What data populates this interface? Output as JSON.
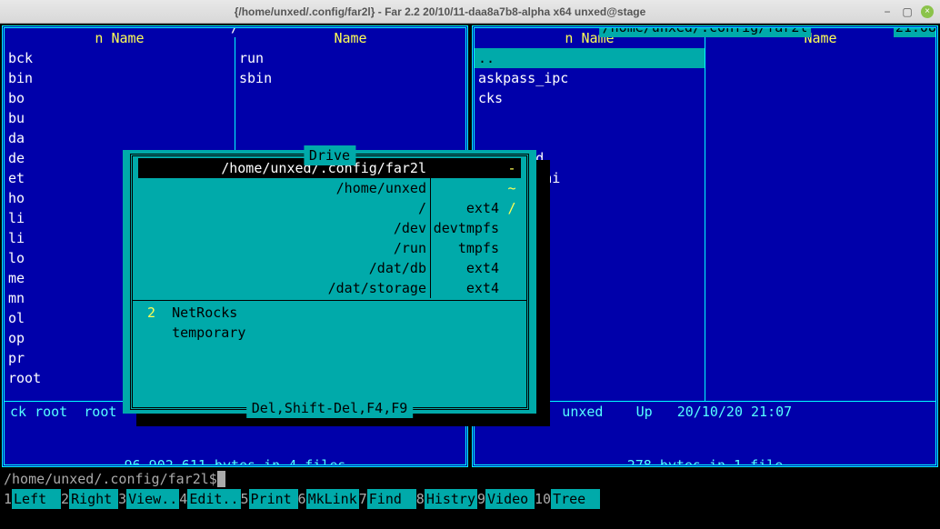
{
  "window": {
    "title": "{/home/unxed/.config/far2l} - Far 2.2 20/10/11-daa8a7b8-alpha x64 unxed@stage"
  },
  "clock": "21:08",
  "left_panel": {
    "path": "/",
    "col1_header": "n     Name",
    "col2_header": "Name",
    "col1": [
      "bck",
      "bin",
      "bo",
      "bu",
      "da",
      "de",
      "et",
      "ho",
      "li",
      "li",
      "lo",
      "me",
      "mn",
      "ol",
      "op",
      "pr",
      "root"
    ],
    "col2": [
      "run",
      "sbin"
    ],
    "stat": "ck root  root   Folder 08/09/17 14:09",
    "summary": "96 902 611 bytes in 4 files"
  },
  "right_panel": {
    "path": "/home/unxed/.config/far2l",
    "col1_header": "n     Name",
    "col2_header": "Name",
    "col1": [
      "..",
      "askpass_ipc",
      "cks",
      "",
      "",
      "lipboard",
      "pboard.ini"
    ],
    "stat": ".. unxed  unxed    Up   20/10/20 21:07",
    "summary": "278 bytes in 1 file"
  },
  "cmdline": {
    "prompt": "/home/unxed/.config/far2l$"
  },
  "fkeys": [
    {
      "n": "1",
      "l": "Left  "
    },
    {
      "n": "2",
      "l": "Right "
    },
    {
      "n": "3",
      "l": "View.."
    },
    {
      "n": "4",
      "l": "Edit.."
    },
    {
      "n": "5",
      "l": "Print "
    },
    {
      "n": "6",
      "l": "MkLink"
    },
    {
      "n": "7",
      "l": "Find  "
    },
    {
      "n": "8",
      "l": "Histry"
    },
    {
      "n": "9",
      "l": "Video "
    },
    {
      "n": "10",
      "l": "Tree  "
    }
  ],
  "dialog": {
    "title": " Drive ",
    "footer": " Del,Shift-Del,F4,F9 ",
    "drives": [
      {
        "path": "/home/unxed/.config/far2l",
        "fs": "",
        "ext": "-",
        "selected": true
      },
      {
        "path": "/home/unxed",
        "fs": "",
        "ext": "~"
      },
      {
        "path": "/",
        "fs": "ext4",
        "ext": "/"
      },
      {
        "path": "/dev",
        "fs": "devtmpfs",
        "ext": ""
      },
      {
        "path": "/run",
        "fs": "tmpfs",
        "ext": ""
      },
      {
        "path": "/dat/db",
        "fs": "ext4",
        "ext": ""
      },
      {
        "path": "/dat/storage",
        "fs": "ext4",
        "ext": ""
      }
    ],
    "extra": [
      {
        "num": "2",
        "label": "NetRocks"
      },
      {
        "num": " ",
        "label": "temporary"
      }
    ]
  }
}
